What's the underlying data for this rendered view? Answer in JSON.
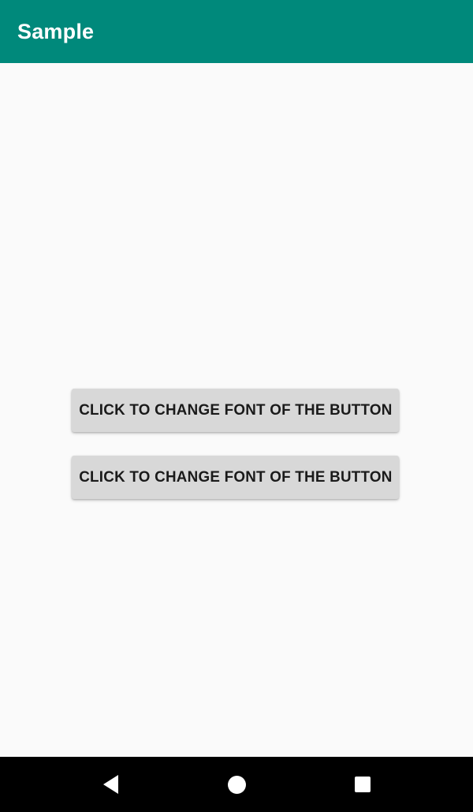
{
  "app": {
    "title": "Sample",
    "appbar_color": "#00897b",
    "background_color": "#fafafa"
  },
  "main": {
    "buttons": [
      {
        "id": "button-primary",
        "label": "CLICK TO CHANGE FONT OF THE BUTTON",
        "fill_color": "#d8d8d8",
        "text_color": "#1a1a1a"
      },
      {
        "id": "button-secondary",
        "label": "CLICK TO CHANGE FONT OF THE BUTTON",
        "fill_color": "#d8d8d8",
        "text_color": "#1a1a1a"
      }
    ]
  },
  "navbar": {
    "background_color": "#000000",
    "items": [
      {
        "name": "back",
        "icon": "triangle-left-icon"
      },
      {
        "name": "home",
        "icon": "circle-icon"
      },
      {
        "name": "recents",
        "icon": "square-icon"
      }
    ]
  }
}
